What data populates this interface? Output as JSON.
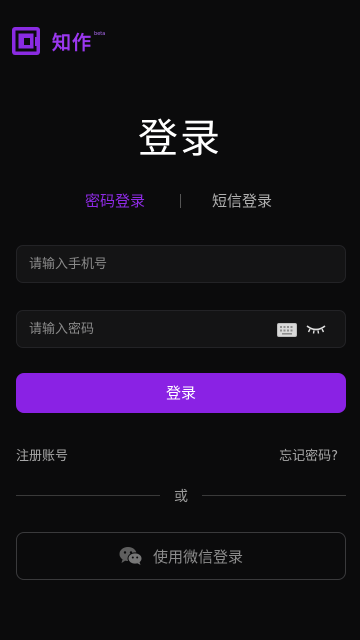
{
  "brand": {
    "name": "知作",
    "sup": "beta"
  },
  "title": "登录",
  "tabs": [
    {
      "label": "密码登录",
      "active": true
    },
    {
      "label": "短信登录",
      "active": false
    }
  ],
  "phone_field": {
    "placeholder": "请输入手机号",
    "value": ""
  },
  "password_field": {
    "placeholder": "请输入密码",
    "value": ""
  },
  "login_button": "登录",
  "register_link": "注册账号",
  "forgot_link": "忘记密码?",
  "divider_text": "或",
  "wechat_button": "使用微信登录",
  "colors": {
    "accent": "#8a22e4",
    "background": "#0b0b0c",
    "field": "#141415"
  }
}
